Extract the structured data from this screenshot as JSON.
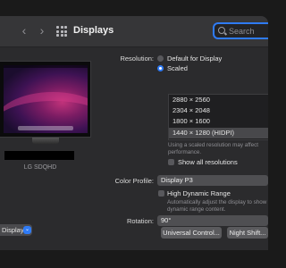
{
  "window": {
    "title": "Displays"
  },
  "search": {
    "placeholder": "Search"
  },
  "monitor": {
    "name": "LG SDQHD"
  },
  "sidebar": {
    "display_select": "Display"
  },
  "resolution": {
    "label": "Resolution:",
    "options": [
      "Default for Display",
      "Scaled"
    ],
    "selected_option": "Scaled",
    "list": [
      "2880 × 2560",
      "2304 × 2048",
      "1800 × 1600",
      "1440 × 1280 (HIDPI)"
    ],
    "selected_index": 3,
    "note": "Using a scaled resolution may affect performance.",
    "show_all_label": "Show all resolutions"
  },
  "color_profile": {
    "label": "Color Profile:",
    "value": "Display P3"
  },
  "hdr": {
    "label": "High Dynamic Range",
    "note": "Automatically adjust the display to show dynamic range content."
  },
  "rotation": {
    "label": "Rotation:",
    "value": "90°"
  },
  "buttons": {
    "universal_control": "Universal Control...",
    "night_shift": "Night Shift..."
  },
  "colors": {
    "accent": "#2f7bf5",
    "window_bg": "#2b2b2d",
    "titlebar_bg": "#363638"
  }
}
